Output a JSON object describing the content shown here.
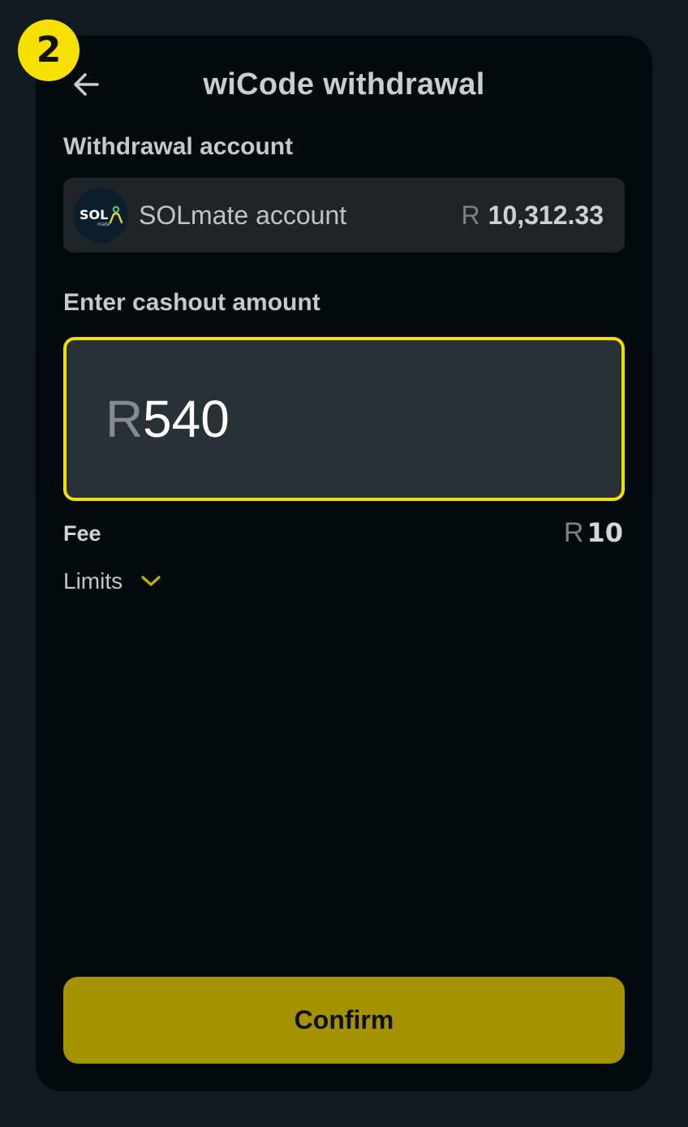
{
  "step_badge": "2",
  "header": {
    "title": "wiCode withdrawal",
    "back_icon": "arrow-left-icon"
  },
  "withdrawal_account": {
    "section_label": "Withdrawal account",
    "logo_text": "SOL",
    "logo_subtext": "mate",
    "logo_icon": "person-icon",
    "name": "SOLmate account",
    "currency": "R",
    "balance": "10,312.33"
  },
  "cashout": {
    "section_label": "Enter cashout amount",
    "currency": "R",
    "value": "540"
  },
  "fee": {
    "label": "Fee",
    "currency": "R",
    "value": "10"
  },
  "limits": {
    "label": "Limits",
    "icon": "chevron-down-icon"
  },
  "confirm": {
    "label": "Confirm"
  },
  "colors": {
    "accent": "#f2de00",
    "button": "#a59200",
    "card_background": "#020a0d",
    "page_background": "#111a1e"
  }
}
